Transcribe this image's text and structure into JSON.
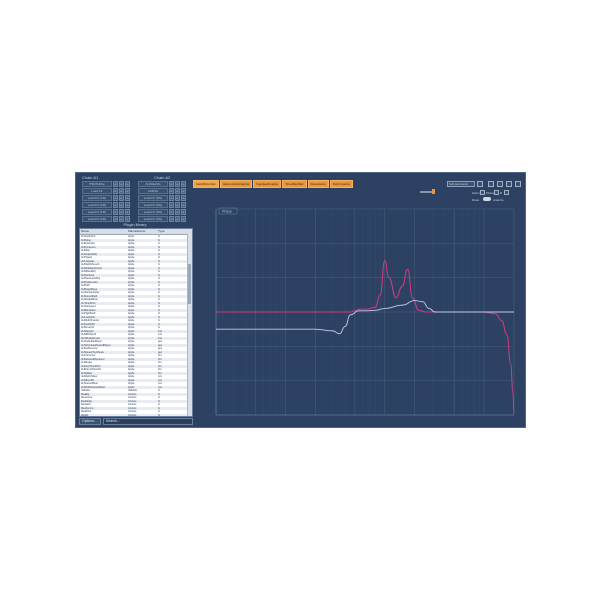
{
  "chains": {
    "a_title": "Chain A1",
    "b_title": "Chain A2",
    "a_slots": [
      "PSDTHFhe",
      "Load FX",
      "Load FX (Filt)",
      "Load FX (Filt)",
      "Load FX (Filt)",
      "Load FX (Filt)"
    ],
    "b_slots": [
      "AUFilterMo",
      "AUDSA",
      "Load FX (Sfx)",
      "Load FX (Sfx)",
      "Load FX (Sfx)",
      "Load FX (Sfx)"
    ],
    "btn_on": "o",
    "btn_edit": "e"
  },
  "library": {
    "title": "Plugin library",
    "headers": [
      "Name",
      "Manufacturer",
      "Type"
    ],
    "rows": [
      [
        "AUAudioUnit",
        "Apple",
        "fx"
      ],
      [
        "AUDelay",
        "Apple",
        "fx"
      ],
      [
        "AUDistortion",
        "Apple",
        "fx"
      ],
      [
        "AUDynamics",
        "Apple",
        "fx"
      ],
      [
        "AUFilter",
        "Apple",
        "fx"
      ],
      [
        "AUGraphicEQ",
        "Apple",
        "fx"
      ],
      [
        "AUHipass",
        "Apple",
        "fx"
      ],
      [
        "AULowpass",
        "Apple",
        "fx"
      ],
      [
        "AUMatrixReverb",
        "Apple",
        "fx"
      ],
      [
        "AUMultibandComp",
        "Apple",
        "fx"
      ],
      [
        "AUNBandEQ",
        "Apple",
        "fx"
      ],
      [
        "AUNetSend",
        "Apple",
        "fx"
      ],
      [
        "AUParametricEQ",
        "Apple",
        "fx"
      ],
      [
        "AUPeakLimiter",
        "Apple",
        "fx"
      ],
      [
        "AUPitch",
        "Apple",
        "fx"
      ],
      [
        "AURogerBeep",
        "Apple",
        "fx"
      ],
      [
        "AUSampleDelay",
        "Apple",
        "fx"
      ],
      [
        "AUSoundField",
        "Apple",
        "fx"
      ],
      [
        "AUSpatialMixer",
        "Apple",
        "fx"
      ],
      [
        "AUTimePitch",
        "Apple",
        "fx"
      ],
      [
        "AUVarispeed",
        "Apple",
        "fx"
      ],
      [
        "AUBandpass",
        "Apple",
        "fx"
      ],
      [
        "AUHighShelf",
        "Apple",
        "fx"
      ],
      [
        "AULowShelf",
        "Apple",
        "fx"
      ],
      [
        "AUMultiChannel",
        "Apple",
        "fx"
      ],
      [
        "AUNewPitch",
        "Apple",
        "fx"
      ],
      [
        "AUReverb2",
        "Apple",
        "fx"
      ],
      [
        "AUSampler",
        "Apple",
        "inst"
      ],
      [
        "AUMIDISynth",
        "Apple",
        "inst"
      ],
      [
        "DLSMusicDevice",
        "Apple",
        "inst"
      ],
      [
        "AUAudioFilePlayer",
        "Apple",
        "gen"
      ],
      [
        "AUScheduledSoundPlayer",
        "Apple",
        "gen"
      ],
      [
        "AUNetReceive",
        "Apple",
        "gen"
      ],
      [
        "AUSpeechSynthesis",
        "Apple",
        "gen"
      ],
      [
        "AUConverter",
        "Apple",
        "fmt"
      ],
      [
        "AUDeferredRenderer",
        "Apple",
        "fmt"
      ],
      [
        "AUMerger",
        "Apple",
        "fmt"
      ],
      [
        "AUNewTimePitch",
        "Apple",
        "fmt"
      ],
      [
        "AURoundTripAAC",
        "Apple",
        "fmt"
      ],
      [
        "AUSplitter",
        "Apple",
        "fmt"
      ],
      [
        "AUMatrixMixer",
        "Apple",
        "mix"
      ],
      [
        "AUMixer3D",
        "Apple",
        "mix"
      ],
      [
        "AUStereoMixer",
        "Apple",
        "mix"
      ],
      [
        "AUMultiChannelMixer",
        "Apple",
        "mix"
      ],
      [
        "Valhalla",
        "Valhalla",
        "fx"
      ],
      [
        "ReaEQ",
        "Cockos",
        "fx"
      ],
      [
        "ReaComp",
        "Cockos",
        "fx"
      ],
      [
        "ReaDelay",
        "Cockos",
        "fx"
      ],
      [
        "ReaVerb",
        "Cockos",
        "fx"
      ],
      [
        "ReaXcomp",
        "Cockos",
        "fx"
      ],
      [
        "ReaPitch",
        "Cockos",
        "fx"
      ],
      [
        "ReaFir",
        "Cockos",
        "fx"
      ],
      [
        "ReaGate",
        "Cockos",
        "fx"
      ],
      [
        "ReaLimit",
        "Cockos",
        "fx"
      ],
      [
        "ReaTune",
        "Cockos",
        "fx"
      ],
      [
        "ReaSynth",
        "Cockos",
        "inst"
      ],
      [
        "ReaSamplOmatic",
        "Cockos",
        "inst"
      ]
    ]
  },
  "footer": {
    "options": "Options...",
    "search": "Search..."
  },
  "tabs": [
    "Gain/Distortion",
    "Harmonics/Analysis",
    "Impulse/Analyze",
    "Time/Rectifier",
    "Resonance",
    "Performance"
  ],
  "right_controls": {
    "mode_value": "Sub Harmonic",
    "zoom_label": "Zoom",
    "phase_label": "Phase",
    "r_label": "R",
    "draw_label": "Draw",
    "analyze_label": "Analyze",
    "plot_tag": "Phase",
    "level_label": "Level"
  },
  "colors": {
    "background": "#2d4262",
    "accent": "#e8973a",
    "curve_pink": "#d43c7c",
    "curve_light": "#c7c8ee",
    "grid": "#4a6181"
  },
  "chart_data": {
    "type": "line",
    "xscale": "log",
    "xlim": [
      20,
      20000
    ],
    "ylim": [
      -18,
      18
    ],
    "grid": true,
    "series": [
      {
        "x": [
          20,
          100,
          200,
          300,
          350,
          450,
          500,
          550,
          650,
          800,
          900,
          1000,
          1100,
          1300,
          1500,
          1700,
          1900,
          2200,
          2600,
          3000,
          4000,
          6000,
          10000,
          13000,
          15000,
          17000,
          18500,
          19500,
          20000
        ],
        "y": [
          0,
          0,
          0,
          0,
          0,
          0,
          0.2,
          0.5,
          0.5,
          0.8,
          3,
          9,
          6,
          2.5,
          4.5,
          7.5,
          2.5,
          0.3,
          0,
          0,
          0,
          0,
          0,
          -0.3,
          -1.5,
          -4,
          -9,
          -14,
          -18
        ]
      },
      {
        "x": [
          20,
          100,
          200,
          300,
          350,
          400,
          450,
          550,
          650,
          800,
          1000,
          1500,
          2000,
          2400,
          2800,
          3200,
          4000,
          6000,
          10000,
          20000
        ],
        "y": [
          -3,
          -3,
          -3,
          -3.3,
          -3.8,
          -2.5,
          -0.5,
          0.2,
          0.2,
          0.3,
          0.6,
          1.2,
          2,
          1.8,
          0.6,
          0,
          0,
          0,
          0,
          0
        ]
      }
    ]
  }
}
